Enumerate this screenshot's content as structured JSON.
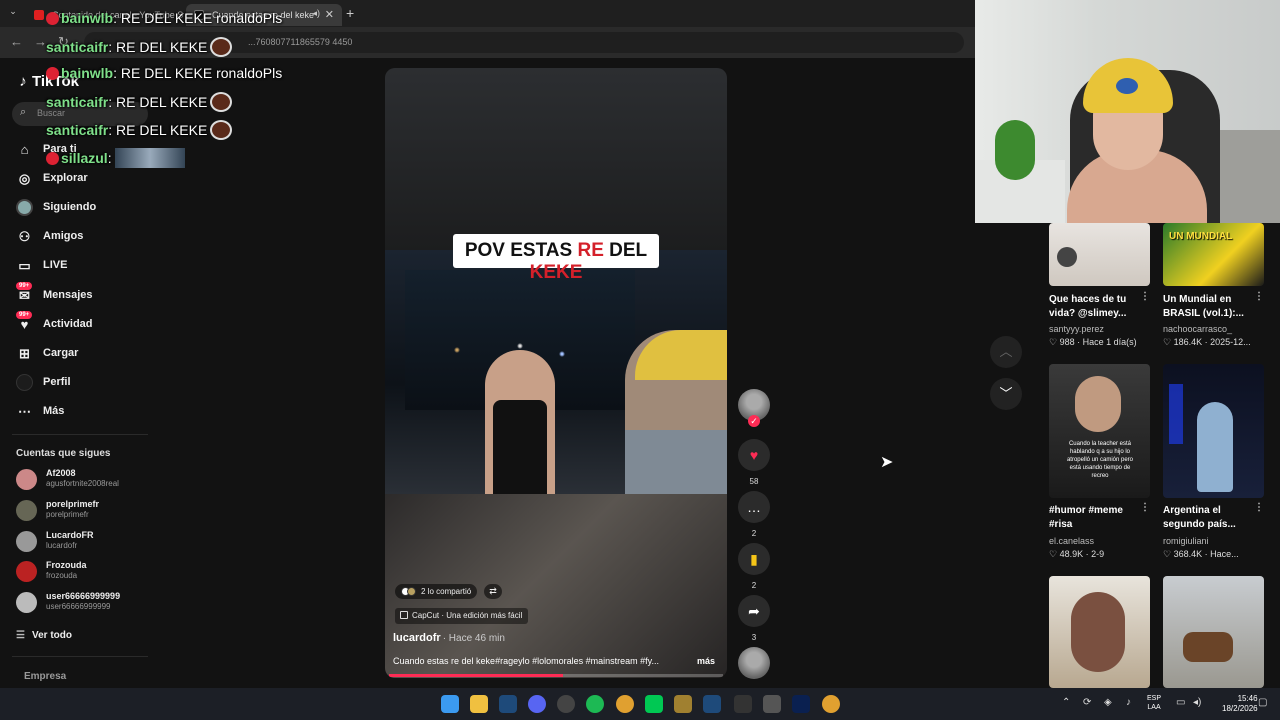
{
  "browser": {
    "tabs": [
      {
        "label": "Contenido del canal - YouTube Studio"
      },
      {
        "label": "Cuando estas re del keke"
      }
    ],
    "url": "...760807711865579 4450"
  },
  "sidebar": {
    "logo": "TikTok",
    "search_placeholder": "Buscar",
    "items": [
      {
        "label": "Para ti",
        "icon": "home-icon"
      },
      {
        "label": "Explorar",
        "icon": "compass-icon"
      },
      {
        "label": "Siguiendo",
        "icon": "following-avatar-icon"
      },
      {
        "label": "Amigos",
        "icon": "friends-icon"
      },
      {
        "label": "LIVE",
        "icon": "live-icon"
      },
      {
        "label": "Mensajes",
        "icon": "messages-icon",
        "badge": "99+"
      },
      {
        "label": "Actividad",
        "icon": "activity-icon",
        "badge": "99+"
      },
      {
        "label": "Cargar",
        "icon": "upload-icon"
      },
      {
        "label": "Perfil",
        "icon": "profile-icon"
      },
      {
        "label": "Más",
        "icon": "more-icon"
      }
    ],
    "following_title": "Cuentas que sigues",
    "following": [
      {
        "name": "Af2008",
        "handle": "agusfortnite2008real"
      },
      {
        "name": "porelprimefr",
        "handle": "porelprimefr"
      },
      {
        "name": "LucardoFR",
        "handle": "lucardofr"
      },
      {
        "name": "Frozouda",
        "handle": "frozouda"
      },
      {
        "name": "user66666999999",
        "handle": "user66666999999"
      }
    ],
    "see_all": "Ver todo",
    "company": "Empresa"
  },
  "chat": [
    {
      "user": "bainwlb",
      "text": " RE DEL KEKE ronaldoPls"
    },
    {
      "user": "santicaifr",
      "text": " RE DEL KEKE"
    },
    {
      "user": "bainwlb",
      "text": " RE DEL KEKE ronaldoPls"
    },
    {
      "user": "santicaifr",
      "text": " RE DEL KEKE"
    },
    {
      "user": "santicaifr",
      "text": " RE DEL KEKE"
    },
    {
      "user": "sillazul",
      "text": ""
    }
  ],
  "video": {
    "overlay_title_a": "POV ESTAS ",
    "overlay_title_b": "RE",
    "overlay_title_c": " DEL ",
    "overlay_title_d": "KEKE",
    "shared_text": "2 lo compartió",
    "capcut_text": "CapCut · Una edición más fácil",
    "author": "lucardofr",
    "time": "· Hace 46 min",
    "caption": "Cuando estas re del keke#rageylo #lolomorales #mainstream #fy...",
    "more": "más",
    "progress": 0.52
  },
  "actions": {
    "likes": "58",
    "comments": "2",
    "saves": "2",
    "shares": "3"
  },
  "feed": [
    {
      "title": "Que haces de tu vida? @slimey...",
      "author": "santyyy.perez",
      "likes": "988",
      "time": "Hace 1 día(s)",
      "thumb_text": ""
    },
    {
      "title": "Un Mundial en BRASIL (vol.1):...",
      "author": "nachoocarrasco_",
      "likes": "186.4K",
      "time": "2025-12...",
      "thumb_text": "UN MUNDIAL"
    },
    {
      "title": "#humor #meme #risa",
      "author": "el.canelass",
      "likes": "48.9K",
      "time": "2-9",
      "thumb_text": "Cuando la teacher está hablando q a su hijo lo atropelló un camión pero está usando tiempo de recreo"
    },
    {
      "title": "Argentina el segundo país...",
      "author": "romigiuliani",
      "likes": "368.4K",
      "time": "Hace...",
      "thumb_text": ""
    }
  ],
  "taskbar": {
    "lang_top": "ESP",
    "lang_bottom": "LAA",
    "time": "15:46",
    "date": "18/2/2026"
  },
  "colors": {
    "accent": "#fe2c55",
    "background": "#121212",
    "chat_user": "#7fe08a"
  }
}
